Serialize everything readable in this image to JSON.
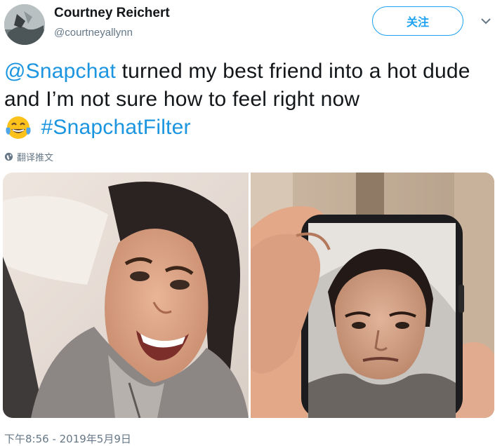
{
  "user": {
    "display_name": "Courtney Reichert",
    "handle": "@courtneyallynn",
    "avatar_icon": "user-avatar"
  },
  "follow_label": "关注",
  "menu_icon": "chevron-down-icon",
  "tweet": {
    "mention": "@Snapchat",
    "text_main": " turned my best friend into a hot dude and I’m not sure how to feel right now",
    "emoji": "face-with-tears-of-joy",
    "hashtag": "#SnapchatFilter"
  },
  "translate_label": "翻译推文",
  "translate_icon": "globe-icon",
  "timestamp": "下午8:56 - 2019年5月9日",
  "colors": {
    "accent": "#1da1f2",
    "link": "#1b95e0",
    "secondary_text": "#657786"
  }
}
